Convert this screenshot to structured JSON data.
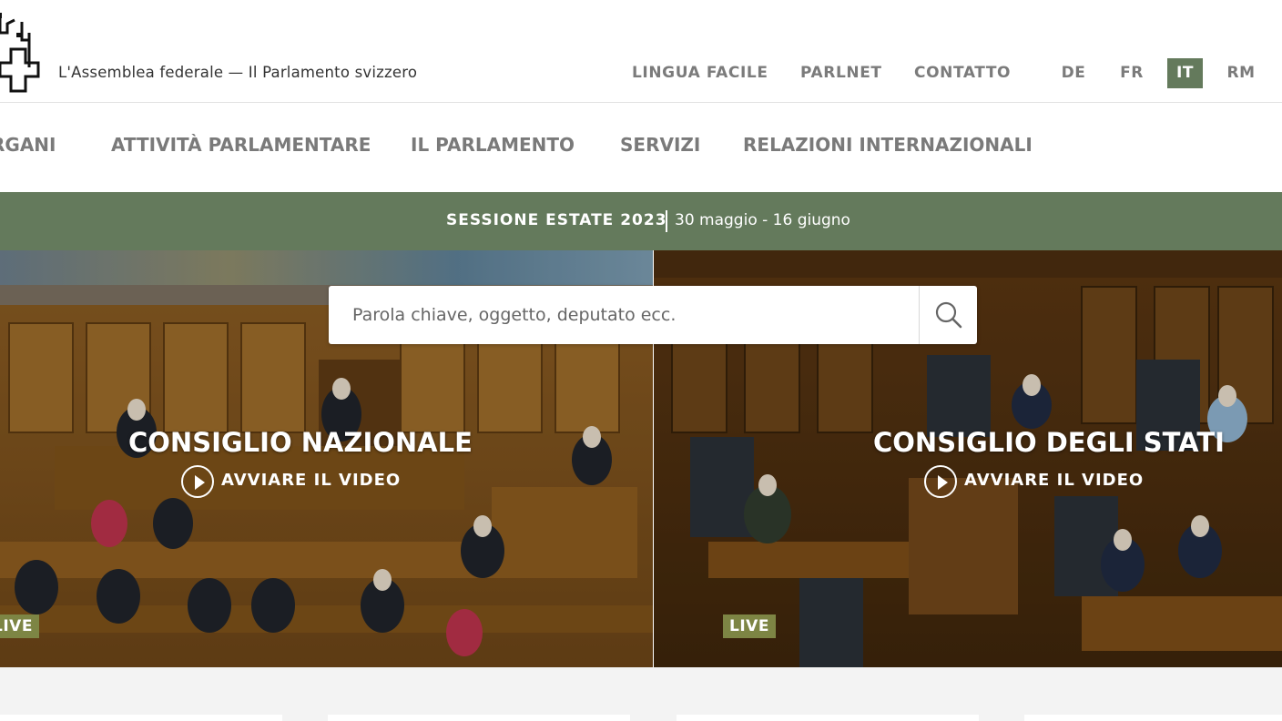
{
  "header": {
    "site_title": "L'Assemblea federale — Il Parlamento svizzero",
    "service_links": [
      "LINGUA FACILE",
      "PARLNET",
      "CONTATTO"
    ],
    "languages": [
      {
        "code": "DE",
        "active": false
      },
      {
        "code": "FR",
        "active": false
      },
      {
        "code": "IT",
        "active": true
      },
      {
        "code": "RM",
        "active": false
      }
    ]
  },
  "nav": {
    "items": [
      "ORGANI",
      "ATTIVITÀ PARLAMENTARE",
      "IL PARLAMENTO",
      "SERVIZI",
      "RELAZIONI INTERNAZIONALI"
    ]
  },
  "session": {
    "title": "SESSIONE ESTATE 2023",
    "dates": "30 maggio - 16 giugno"
  },
  "search": {
    "placeholder": "Parola chiave, oggetto, deputato ecc.",
    "icon": "search-icon"
  },
  "panels": [
    {
      "title": "CONSIGLIO NAZIONALE",
      "video_label": "AVVIARE IL VIDEO",
      "live": "LIVE"
    },
    {
      "title": "CONSIGLIO DEGLI STATI",
      "video_label": "AVVIARE IL VIDEO",
      "live": "LIVE"
    }
  ],
  "colors": {
    "accent_green": "#647a5c",
    "live_badge": "#7d8544",
    "nav_text": "#7a7a7a"
  }
}
